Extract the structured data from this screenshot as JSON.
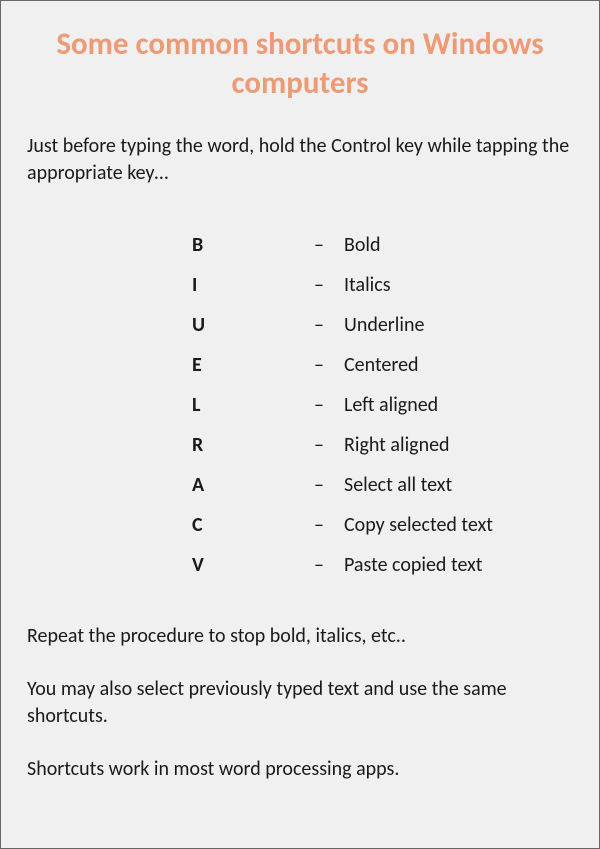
{
  "title": "Some common shortcuts on Windows computers",
  "intro": "Just before typing the word, hold the Control key while tapping the appropriate key…",
  "shortcuts": [
    {
      "key": "B",
      "desc": "Bold"
    },
    {
      "key": "I",
      "desc": "Italics"
    },
    {
      "key": "U",
      "desc": "Underline"
    },
    {
      "key": "E",
      "desc": "Centered"
    },
    {
      "key": "L",
      "desc": "Left aligned"
    },
    {
      "key": "R",
      "desc": "Right aligned"
    },
    {
      "key": "A",
      "desc": "Select all text"
    },
    {
      "key": "C",
      "desc": "Copy selected text"
    },
    {
      "key": "V",
      "desc": "Paste copied text"
    }
  ],
  "dash": "–",
  "footer1": "Repeat the procedure to stop bold, italics, etc..",
  "footer2": "You may also select previously typed text and use the same shortcuts.",
  "footer3": "Shortcuts work in most word processing apps."
}
